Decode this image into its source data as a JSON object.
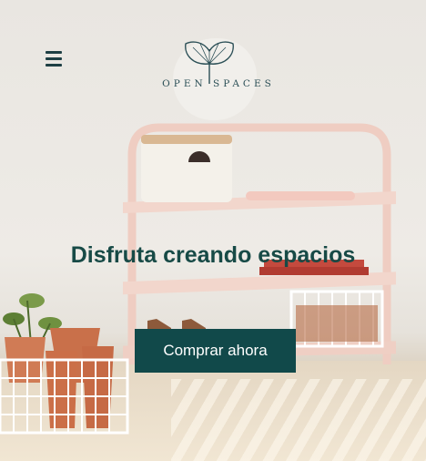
{
  "header": {
    "menu_icon": "hamburger-menu-icon",
    "logo_text": "OPEN SPACES",
    "logo_icon": "ginkgo-leaf-icon"
  },
  "hero": {
    "headline": "Disfruta creando espacios",
    "cta_label": "Comprar ahora"
  },
  "colors": {
    "brand": "#11494a",
    "headline": "#174a46",
    "logo": "#2b4f56",
    "shelf": "#f0cfc5"
  }
}
